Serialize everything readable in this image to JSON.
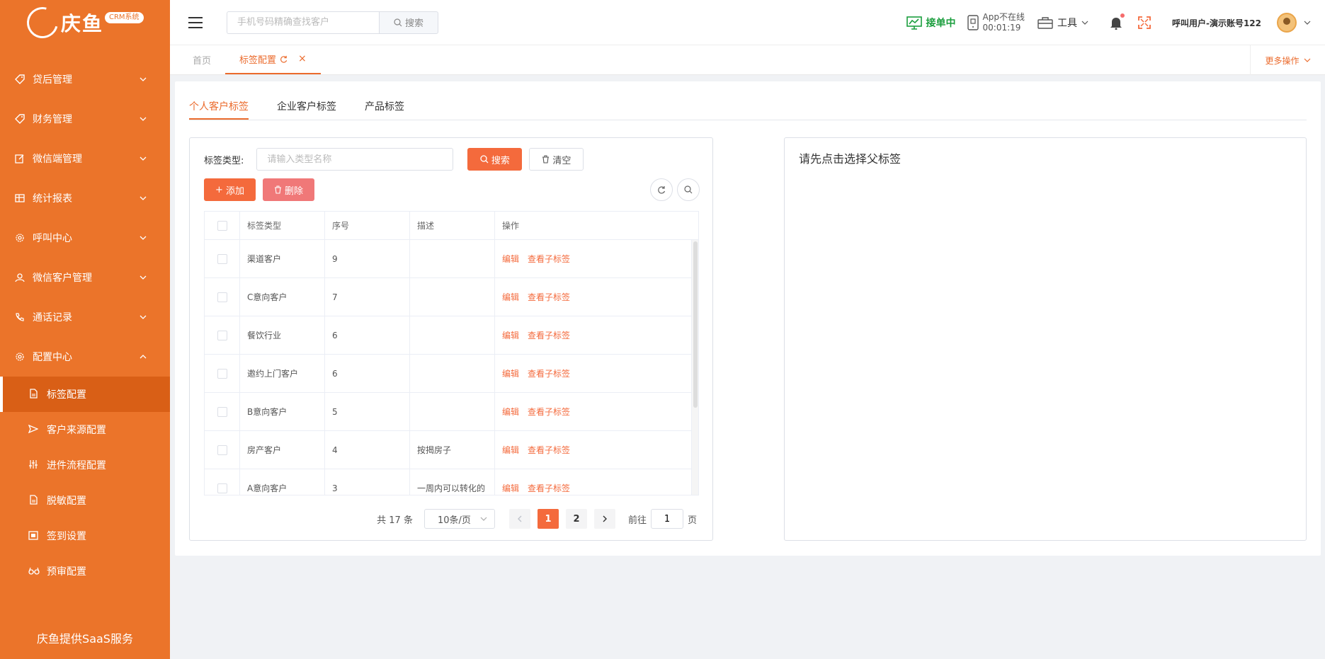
{
  "logo": {
    "text": "庆鱼",
    "badge": "CRM系统"
  },
  "sidebar": {
    "menus": [
      {
        "label": "贷后管理",
        "icon": "tag-icon"
      },
      {
        "label": "财务管理",
        "icon": "tag-icon"
      },
      {
        "label": "微信端管理",
        "icon": "edit-icon"
      },
      {
        "label": "统计报表",
        "icon": "table-icon"
      },
      {
        "label": "呼叫中心",
        "icon": "gear-icon"
      },
      {
        "label": "微信客户管理",
        "icon": "user-icon"
      },
      {
        "label": "通话记录",
        "icon": "phone-icon"
      },
      {
        "label": "配置中心",
        "icon": "gear-icon"
      }
    ],
    "submenu": [
      {
        "label": "标签配置",
        "icon": "document-icon"
      },
      {
        "label": "客户来源配置",
        "icon": "send-icon"
      },
      {
        "label": "进件流程配置",
        "icon": "sliders-icon"
      },
      {
        "label": "脱敏配置",
        "icon": "document-icon"
      },
      {
        "label": "签到设置",
        "icon": "calendar-icon"
      },
      {
        "label": "预审配置",
        "icon": "glasses-icon"
      }
    ],
    "footer": "庆鱼提供SaaS服务"
  },
  "header": {
    "search_placeholder": "手机号码精确查找客户",
    "search_button": "搜索",
    "order_status": "接单中",
    "app_status": "App不在线",
    "app_timer": "00:01:19",
    "tools_label": "工具",
    "username": "呼叫用户-演示账号122"
  },
  "page_tabs": {
    "home": "首页",
    "current": "标签配置",
    "close": "×",
    "more": "更多操作"
  },
  "inner_tabs": [
    "个人客户标签",
    "企业客户标签",
    "产品标签"
  ],
  "filter": {
    "label": "标签类型:",
    "placeholder": "请输入类型名称",
    "search_label": "搜索",
    "clear_label": "清空"
  },
  "actions": {
    "add_label": "添加",
    "delete_label": "删除"
  },
  "table": {
    "columns": [
      "标签类型",
      "序号",
      "描述",
      "操作"
    ],
    "rows": [
      {
        "type": "渠道客户",
        "seq": "9",
        "desc": ""
      },
      {
        "type": "C意向客户",
        "seq": "7",
        "desc": ""
      },
      {
        "type": "餐饮行业",
        "seq": "6",
        "desc": ""
      },
      {
        "type": "邀约上门客户",
        "seq": "6",
        "desc": ""
      },
      {
        "type": "B意向客户",
        "seq": "5",
        "desc": ""
      },
      {
        "type": "房产客户",
        "seq": "4",
        "desc": "按揭房子"
      },
      {
        "type": "A意向客户",
        "seq": "3",
        "desc": "一周内可以转化的"
      }
    ],
    "op_edit": "编辑",
    "op_view": "查看子标签"
  },
  "pagination": {
    "total": "共 17 条",
    "page_size": "10条/页",
    "pages": [
      "1",
      "2"
    ],
    "goto_label": "前往",
    "goto_value": "1",
    "page_unit": "页"
  },
  "right_panel": {
    "hint": "请先点击选择父标签"
  },
  "colors": {
    "primary": "#eb742a",
    "accent": "#f46a3c",
    "success": "#1b9e3e"
  }
}
